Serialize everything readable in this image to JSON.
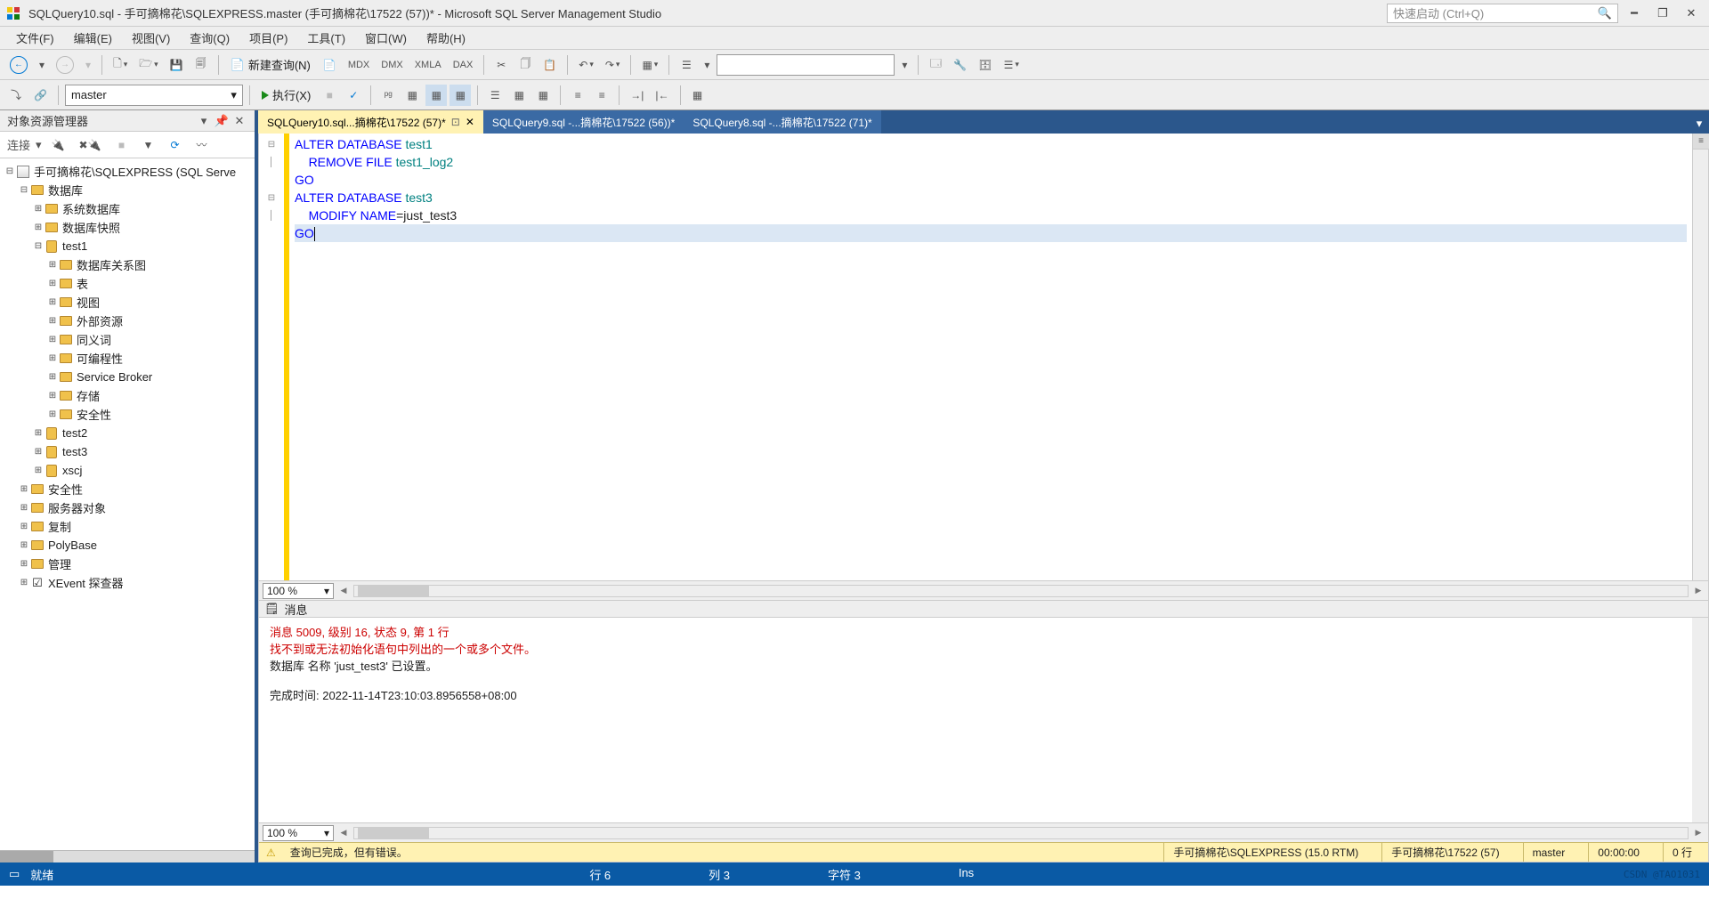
{
  "title": "SQLQuery10.sql - 手可摘棉花\\SQLEXPRESS.master (手可摘棉花\\17522 (57))* - Microsoft SQL Server Management Studio",
  "quicklaunch_placeholder": "快速启动 (Ctrl+Q)",
  "menus": [
    "文件(F)",
    "编辑(E)",
    "视图(V)",
    "查询(Q)",
    "项目(P)",
    "工具(T)",
    "窗口(W)",
    "帮助(H)"
  ],
  "toolbar": {
    "newquery": "新建查询(N)",
    "small_labels": [
      "MDX",
      "DMX",
      "XMLA",
      "DAX"
    ]
  },
  "toolbar2": {
    "db": "master",
    "execute": "执行(X)"
  },
  "panel": {
    "title": "对象资源管理器",
    "connect": "连接"
  },
  "tree": {
    "root": "手可摘棉花\\SQLEXPRESS (SQL Serve",
    "databases": "数据库",
    "sysdb": "系统数据库",
    "snapshot": "数据库快照",
    "test1": "test1",
    "t1_children": [
      "数据库关系图",
      "表",
      "视图",
      "外部资源",
      "同义词",
      "可编程性",
      "Service Broker",
      "存储",
      "安全性"
    ],
    "test2": "test2",
    "test3": "test3",
    "xscj": "xscj",
    "others": [
      "安全性",
      "服务器对象",
      "复制",
      "PolyBase",
      "管理",
      "XEvent 探查器"
    ]
  },
  "tabs": [
    {
      "label": "SQLQuery10.sql...摘棉花\\17522 (57)*",
      "active": true
    },
    {
      "label": "SQLQuery9.sql -...摘棉花\\17522 (56))*",
      "active": false
    },
    {
      "label": "SQLQuery8.sql -...摘棉花\\17522 (71)*",
      "active": false
    }
  ],
  "code": {
    "l1_kw": "ALTER DATABASE",
    "l1_id": " test1",
    "l2_pre": "    ",
    "l2_kw": "REMOVE FILE",
    "l2_id": " test1_log2",
    "l3": "GO",
    "l4_kw": "ALTER DATABASE",
    "l4_id": " test3",
    "l5_pre": "    ",
    "l5_kw": "MODIFY NAME",
    "l5_op": "=",
    "l5_id": "just_test3",
    "l6": "GO"
  },
  "zoom": "100 %",
  "messages": {
    "header": "消息",
    "err1": "消息 5009, 级别 16, 状态 9, 第 1 行",
    "err2": "找不到或无法初始化语句中列出的一个或多个文件。",
    "ok1": "数据库 名称 'just_test3' 已设置。",
    "done": "完成时间: 2022-11-14T23:10:03.8956558+08:00"
  },
  "editor_status": {
    "msg": "查询已完成，但有错误。",
    "server": "手可摘棉花\\SQLEXPRESS (15.0 RTM)",
    "user": "手可摘棉花\\17522 (57)",
    "db": "master",
    "time": "00:00:00",
    "rows": "0 行"
  },
  "bluebar": {
    "ready": "就绪",
    "line": "行 6",
    "col": "列 3",
    "ch": "字符 3",
    "ins": "Ins"
  },
  "watermark": "CSDN @TAO1031"
}
